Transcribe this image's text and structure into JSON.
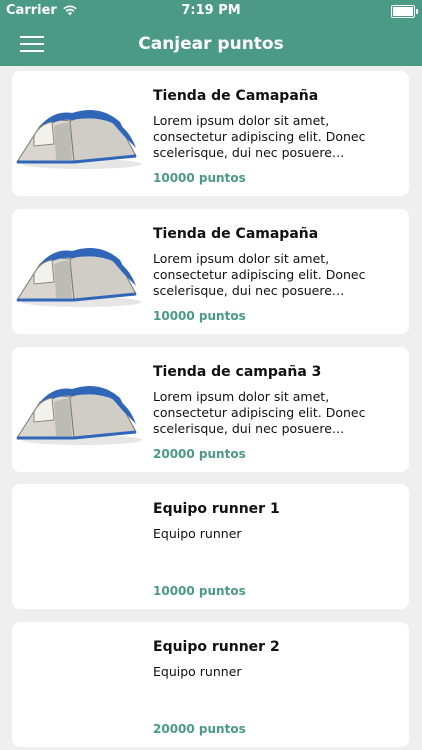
{
  "status_bar": {
    "carrier": "Carrier",
    "time": "7:19 PM"
  },
  "nav": {
    "title": "Canjear puntos"
  },
  "items": [
    {
      "title": "Tienda de Camapaña",
      "description": "Lorem ipsum dolor sit amet, consectetur adipiscing elit. Donec scelerisque, dui nec posuere condimentum, lacus velit faucibus lorem, ac feugiat erat.",
      "points": "10000 puntos",
      "image": "tent-image"
    },
    {
      "title": "Tienda de Camapaña",
      "description": "Lorem ipsum dolor sit amet, consectetur adipiscing elit. Donec scelerisque, dui nec posuere condimentum, lacus velit faucibus lorem, ac feugiat erat.",
      "points": "10000 puntos",
      "image": "tent-image"
    },
    {
      "title": "Tienda de campaña 3",
      "description": "Lorem ipsum dolor sit amet, consectetur adipiscing elit. Donec scelerisque, dui nec posuere condimentum, lacus velit faucibus lorem, ac feugiat erat.",
      "points": "20000 puntos",
      "image": "tent-image"
    },
    {
      "title": "Equipo runner 1",
      "description": "Equipo runner",
      "points": "10000 puntos",
      "image": ""
    },
    {
      "title": "Equipo runner 2",
      "description": "Equipo runner",
      "points": "20000 puntos",
      "image": ""
    }
  ],
  "colors": {
    "accent": "#4a9a86",
    "background": "#efefef",
    "card": "#ffffff"
  }
}
